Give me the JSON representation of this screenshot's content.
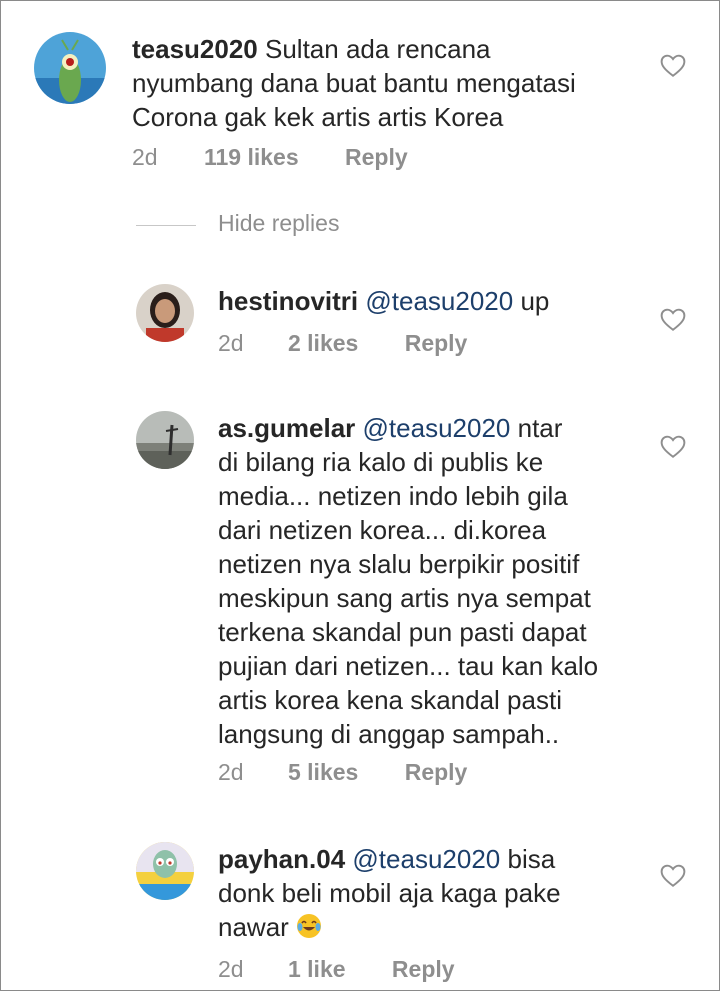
{
  "comments": [
    {
      "username": "teasu2020",
      "mention": "",
      "text": "Sultan ada rencana nyumbang dana buat bantu mengatasi Corona gak kek artis artis Korea",
      "lines": [
        "Sultan ada rencana",
        "nyumbang dana buat bantu mengatasi",
        "Corona gak kek artis artis Korea"
      ],
      "time": "2d",
      "likes": "119 likes",
      "reply_label": "Reply",
      "avatar_icon": "plankton-avatar"
    }
  ],
  "hide_replies_label": "Hide replies",
  "replies": [
    {
      "username": "hestinovitri",
      "mention": "@teasu2020",
      "line1_tail": "up",
      "lines": [],
      "time": "2d",
      "likes": "2 likes",
      "reply_label": "Reply",
      "avatar_icon": "woman-portrait-avatar"
    },
    {
      "username": "as.gumelar",
      "mention": "@teasu2020",
      "line1_tail": "ntar",
      "lines": [
        "di bilang ria kalo di publis ke",
        "media... netizen indo lebih gila",
        "dari netizen korea... di.korea",
        "netizen nya slalu berpikir positif",
        "meskipun sang artis nya sempat",
        "terkena skandal pun pasti dapat",
        "pujian dari netizen... tau kan kalo",
        "artis korea kena skandal pasti",
        "langsung di anggap sampah.."
      ],
      "time": "2d",
      "likes": "5 likes",
      "reply_label": "Reply",
      "avatar_icon": "beach-photo-avatar"
    },
    {
      "username": "payhan.04",
      "mention": "@teasu2020",
      "line1_tail": "bisa",
      "lines": [
        "donk beli mobil aja kaga pake",
        "nawar"
      ],
      "emoji": "face-with-tears-of-joy",
      "time": "2d",
      "likes": "1 like",
      "reply_label": "Reply",
      "avatar_icon": "squidward-avatar"
    }
  ],
  "colors": {
    "text": "#262626",
    "muted": "#8e8e8e",
    "mention": "#1d3f6b"
  }
}
